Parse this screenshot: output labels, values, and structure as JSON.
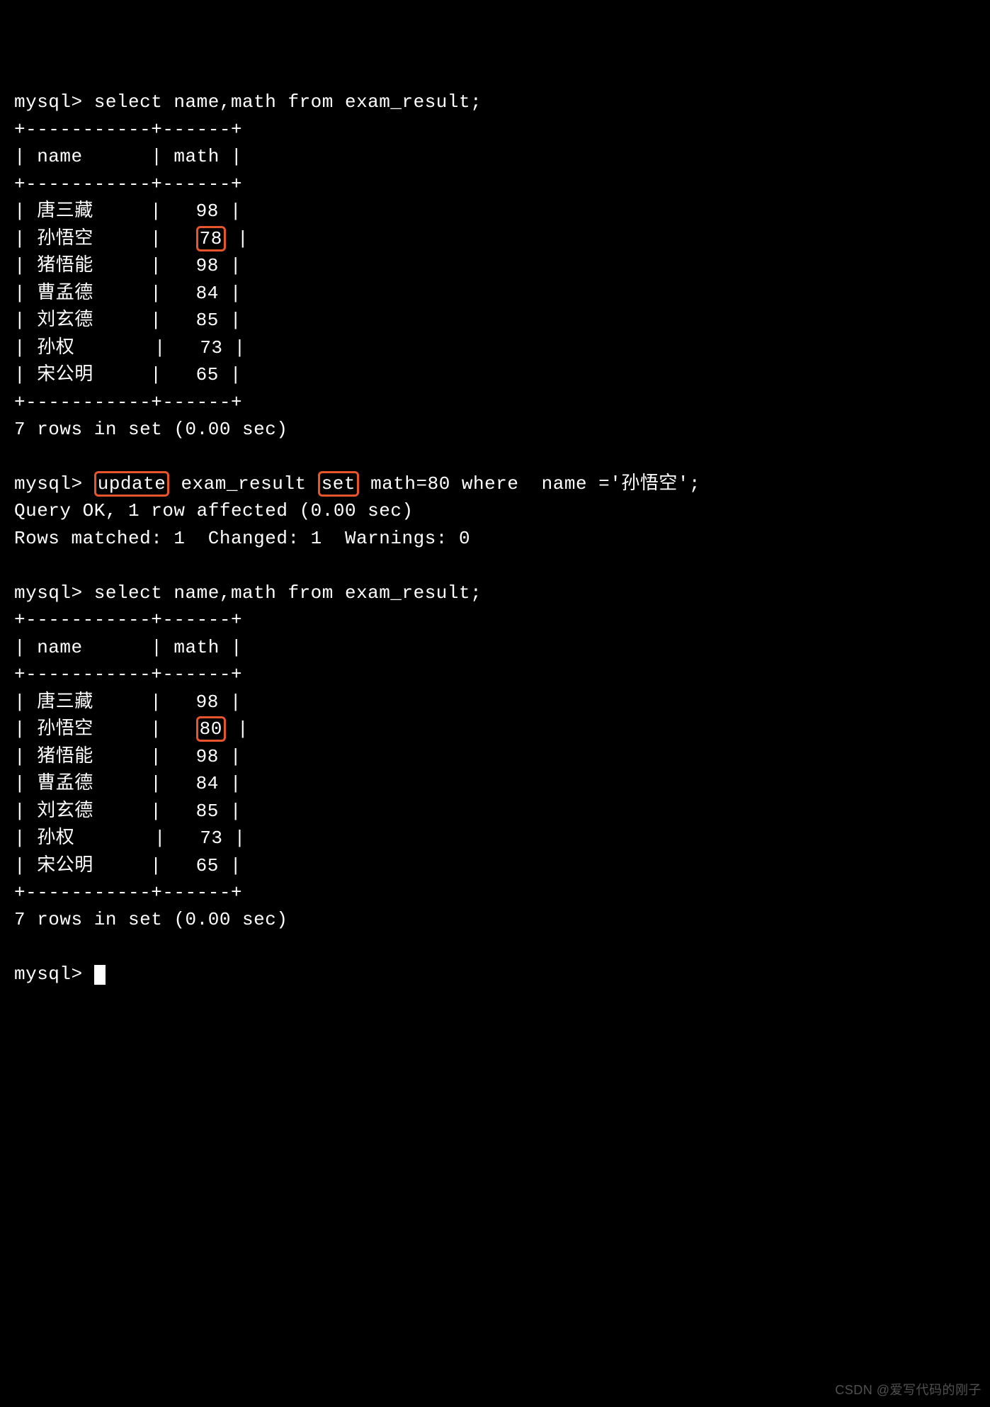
{
  "prompt": "mysql>",
  "query1": "select name,math from exam_result;",
  "divider": "+-----------+------+",
  "header_line": "| name      | math |",
  "table1": [
    {
      "name": "唐三藏",
      "pad": "    ",
      "math": "98",
      "hl": false
    },
    {
      "name": "孙悟空",
      "pad": "    ",
      "math": "78",
      "hl": true
    },
    {
      "name": "猪悟能",
      "pad": "    ",
      "math": "98",
      "hl": false
    },
    {
      "name": "曹孟德",
      "pad": "    ",
      "math": "84",
      "hl": false
    },
    {
      "name": "刘玄德",
      "pad": "    ",
      "math": "85",
      "hl": false
    },
    {
      "name": "孙权",
      "pad": "      ",
      "math": "73",
      "hl": false
    },
    {
      "name": "宋公明",
      "pad": "    ",
      "math": "65",
      "hl": false
    }
  ],
  "rows_msg": "7 rows in set (0.00 sec)",
  "update_line": {
    "kw_update": "update",
    "mid1": "exam_result",
    "kw_set": "set",
    "rest": "math=80 where  name ='孙悟空';"
  },
  "query_ok": "Query OK, 1 row affected (0.00 sec)",
  "rows_matched": "Rows matched: 1  Changed: 1  Warnings: 0",
  "query2": "select name,math from exam_result;",
  "table2": [
    {
      "name": "唐三藏",
      "pad": "    ",
      "math": "98",
      "hl": false
    },
    {
      "name": "孙悟空",
      "pad": "    ",
      "math": "80",
      "hl": true
    },
    {
      "name": "猪悟能",
      "pad": "    ",
      "math": "98",
      "hl": false
    },
    {
      "name": "曹孟德",
      "pad": "    ",
      "math": "84",
      "hl": false
    },
    {
      "name": "刘玄德",
      "pad": "    ",
      "math": "85",
      "hl": false
    },
    {
      "name": "孙权",
      "pad": "      ",
      "math": "73",
      "hl": false
    },
    {
      "name": "宋公明",
      "pad": "    ",
      "math": "65",
      "hl": false
    }
  ],
  "watermark": "CSDN @爱写代码的刚子"
}
